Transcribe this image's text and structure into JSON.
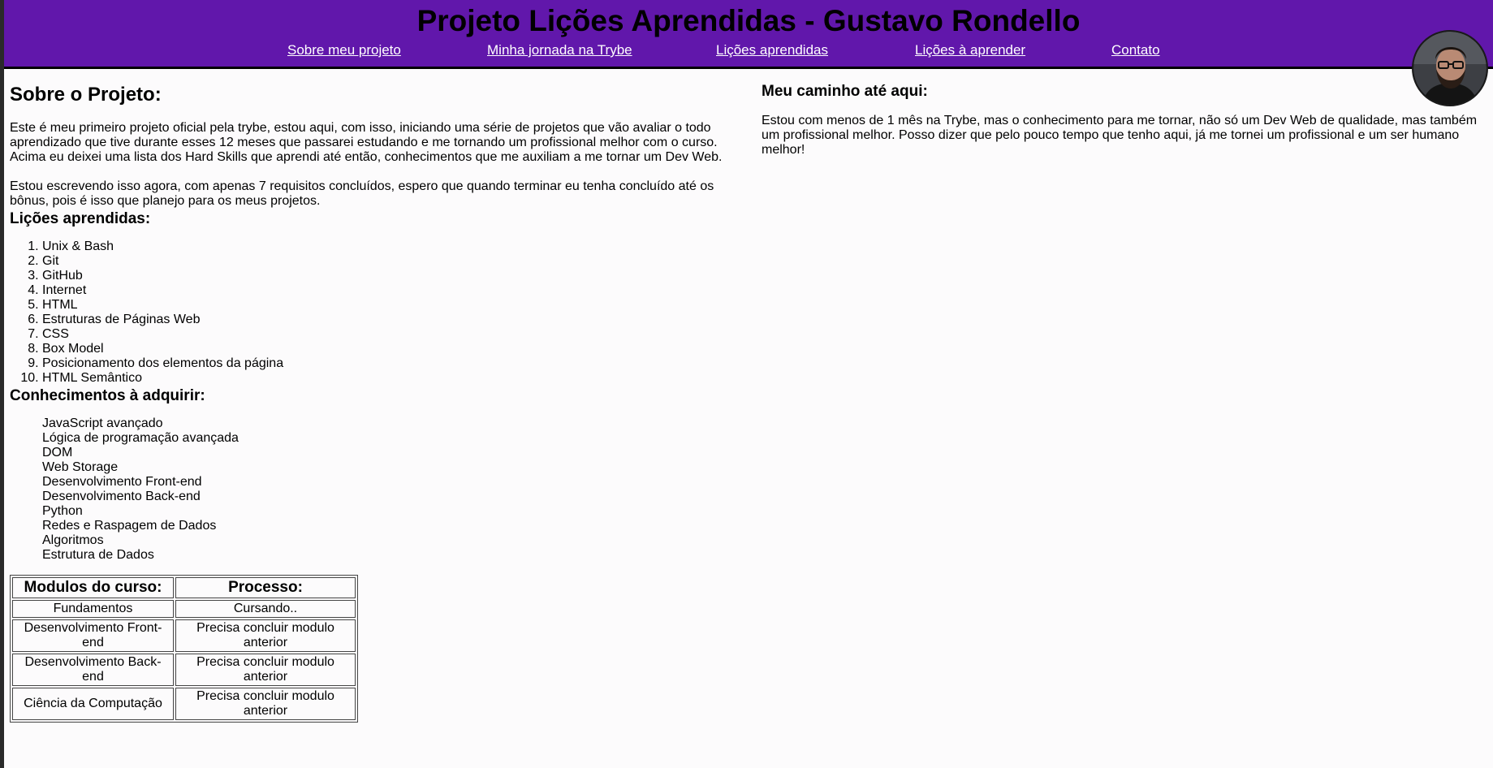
{
  "header": {
    "title": "Projeto Lições Aprendidas - Gustavo Rondello",
    "nav": [
      {
        "label": "Sobre meu projeto"
      },
      {
        "label": "Minha jornada na Trybe"
      },
      {
        "label": "Lições aprendidas"
      },
      {
        "label": "Lições à aprender"
      },
      {
        "label": "Contato"
      }
    ]
  },
  "colors": {
    "header_background": "#6117ab",
    "nav_link": "#ffffff",
    "page_background": "#fcfbfc"
  },
  "about": {
    "title": "Sobre o Projeto:",
    "paragraph1": "Este é meu primeiro projeto oficial pela trybe, estou aqui, com isso, iniciando uma série de projetos que vão avaliar o todo aprendizado que tive durante esses 12 meses que passarei estudando e me tornando um profissional melhor com o curso. Acima eu deixei uma lista dos Hard Skills que aprendi até então, conhecimentos que me auxiliam a me tornar um Dev Web.",
    "paragraph2": "Estou escrevendo isso agora, com apenas 7 requisitos concluídos, espero que quando terminar eu tenha concluído até os bônus, pois é isso que planejo para os meus projetos."
  },
  "lessons": {
    "title": "Lições aprendidas:",
    "items": [
      "Unix & Bash",
      "Git",
      "GitHub",
      "Internet",
      "HTML",
      "Estruturas de Páginas Web",
      "CSS",
      "Box Model",
      "Posicionamento dos elementos da página",
      "HTML Semântico"
    ]
  },
  "knowledge": {
    "title": "Conhecimentos à adquirir:",
    "items": [
      "JavaScript avançado",
      "Lógica de programação avançada",
      "DOM",
      "Web Storage",
      "Desenvolvimento Front-end",
      "Desenvolvimento Back-end",
      "Python",
      "Redes e Raspagem de Dados",
      "Algoritmos",
      "Estrutura de Dados"
    ]
  },
  "modules_table": {
    "headers": [
      "Modulos do curso:",
      "Processo:"
    ],
    "rows": [
      [
        "Fundamentos",
        "Cursando.."
      ],
      [
        "Desenvolvimento Front-end",
        "Precisa concluir modulo anterior"
      ],
      [
        "Desenvolvimento Back-end",
        "Precisa concluir modulo anterior"
      ],
      [
        "Ciência da Computação",
        "Precisa concluir modulo anterior"
      ]
    ]
  },
  "journey": {
    "title": "Meu caminho até aqui:",
    "paragraph": "Estou com menos de 1 mês na Trybe, mas o conhecimento para me tornar, não só um Dev Web de qualidade, mas também um profissional melhor. Posso dizer que pelo pouco tempo que tenho aqui, já me tornei um profissional e um ser humano melhor!"
  },
  "avatar": {
    "icon": "profile-photo"
  }
}
